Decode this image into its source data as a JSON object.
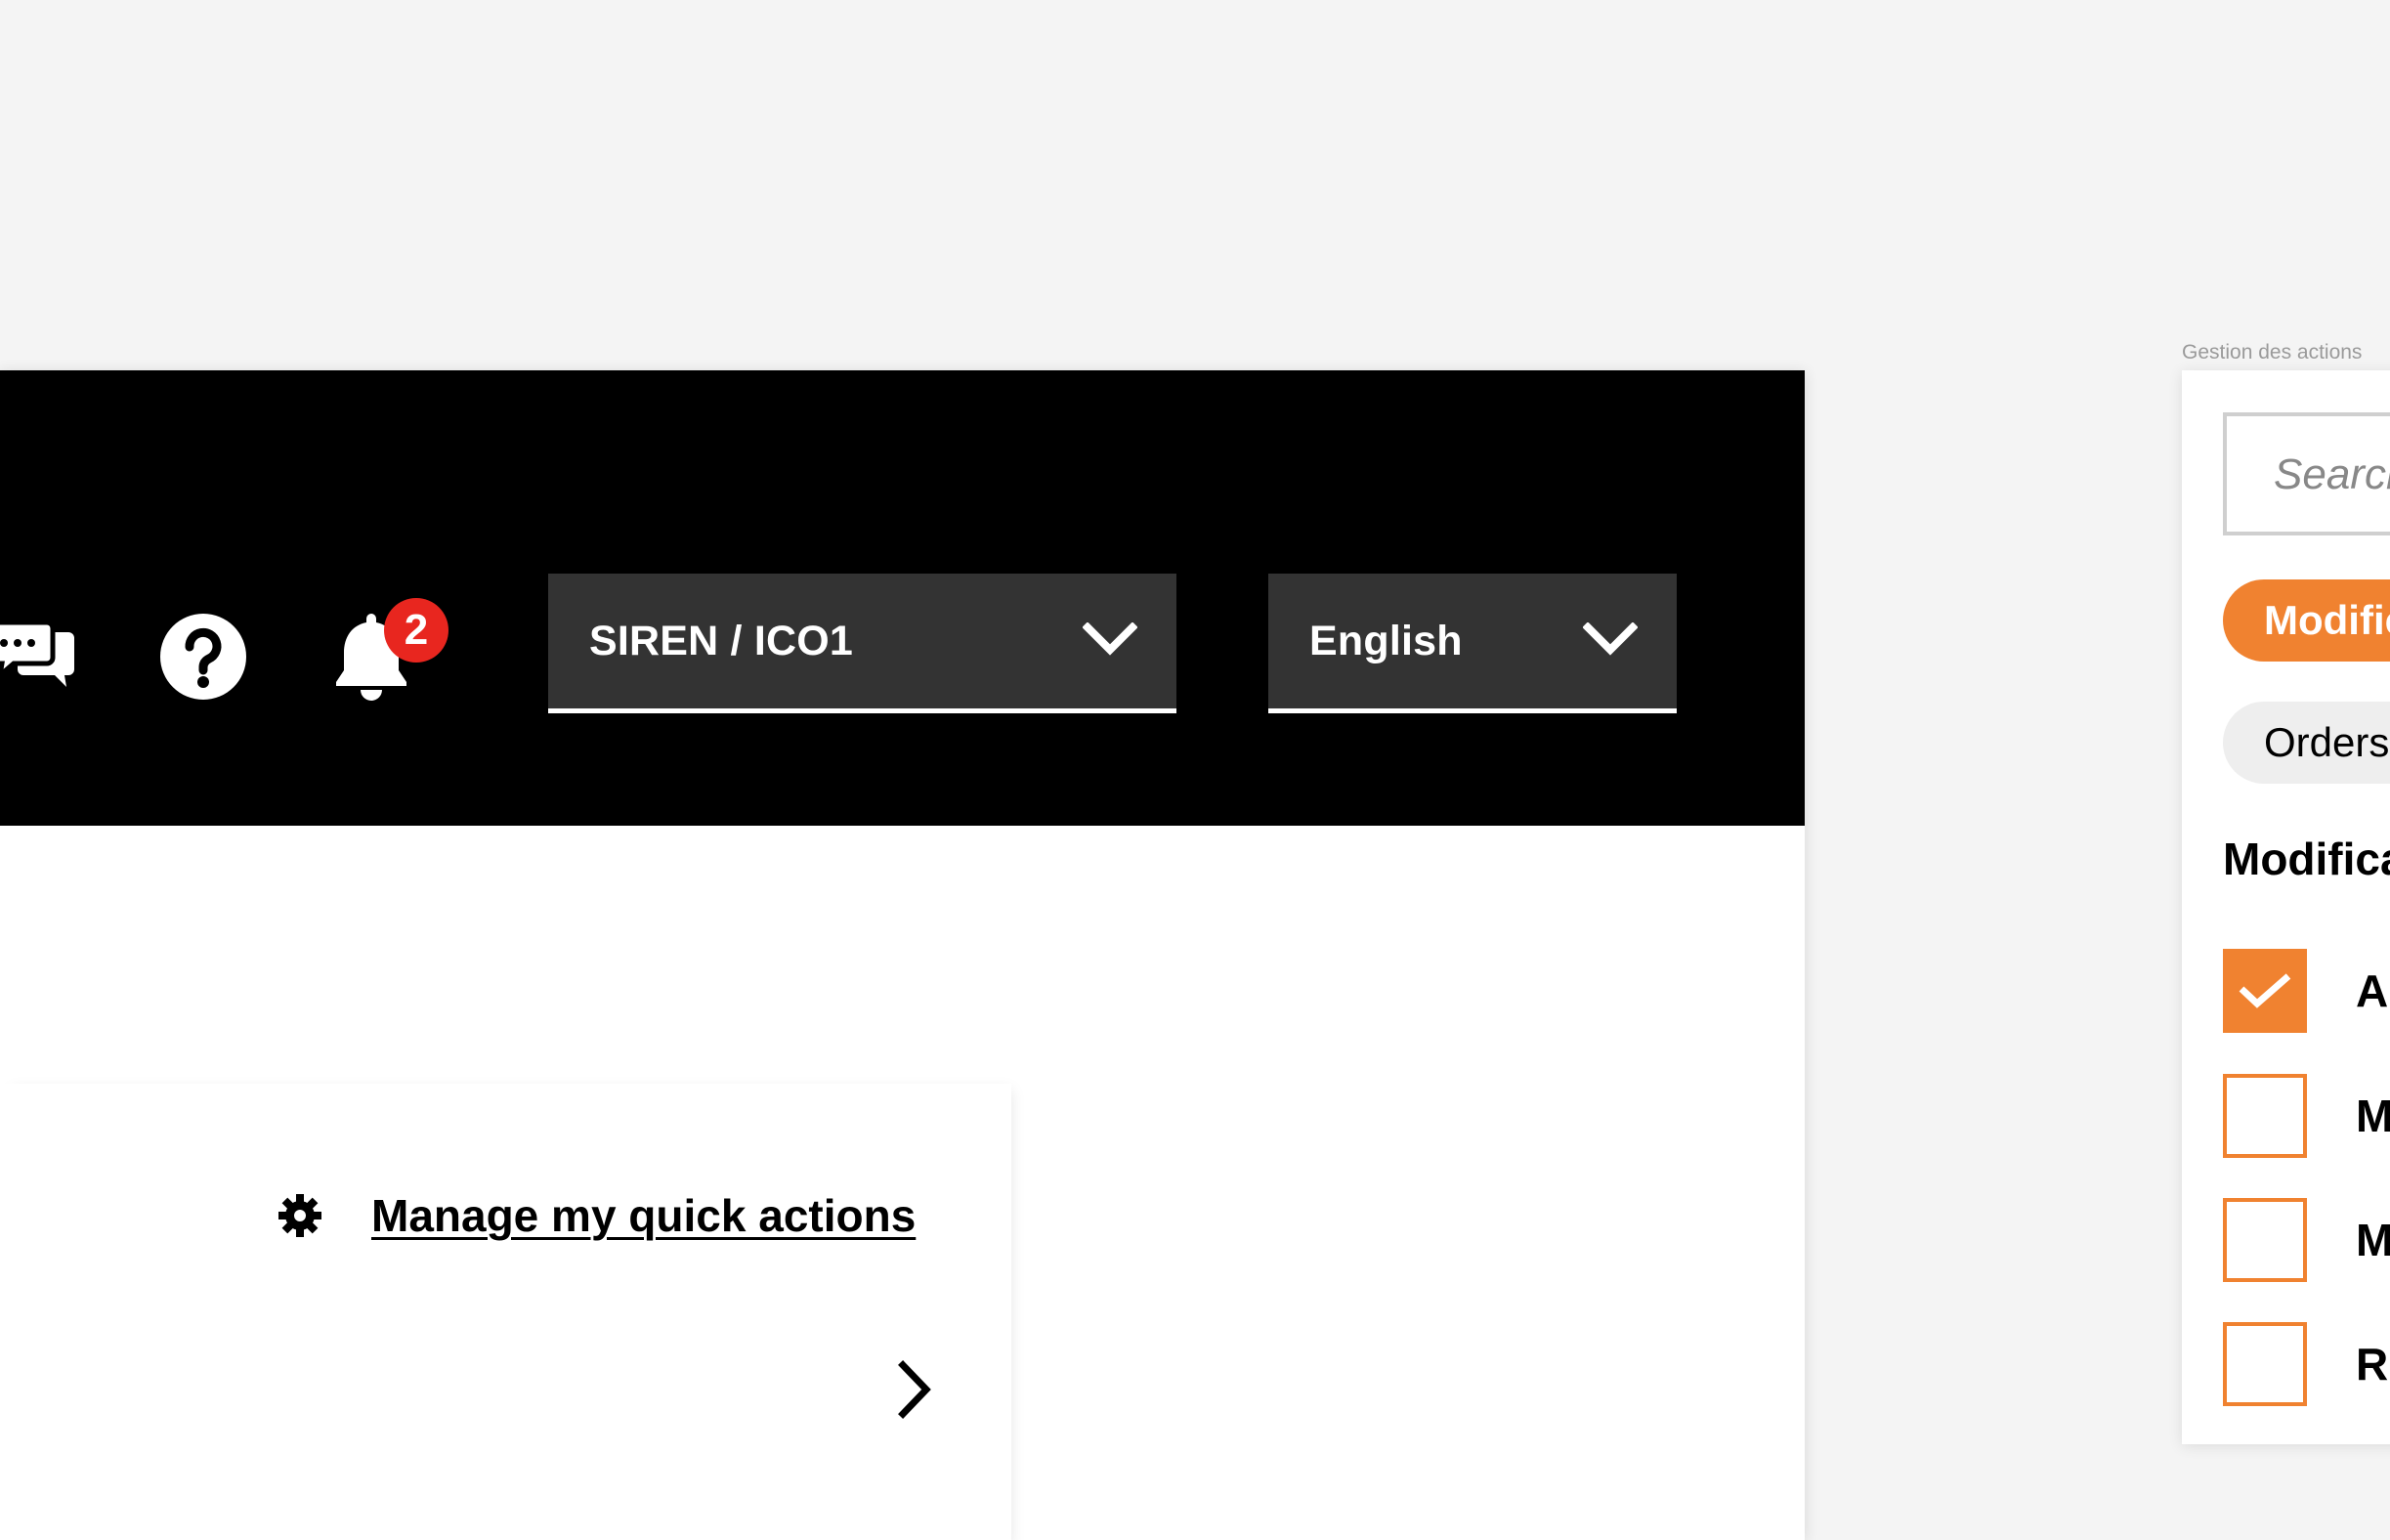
{
  "app": {
    "header": {
      "notification_count": "2",
      "org_select": {
        "value": "SIREN / ICO1"
      },
      "lang_select": {
        "value": "English"
      },
      "icons": [
        "chat-icon",
        "help-icon",
        "bell-icon",
        "chevron-down-icon"
      ]
    },
    "quick_actions": {
      "manage_label": "Manage my quick actions",
      "icons": [
        "gear-icon",
        "chevron-right-icon"
      ]
    }
  },
  "side_frame": {
    "label": "Gestion des actions",
    "search_placeholder": "Search",
    "filters": [
      {
        "label": "Modific",
        "active": true
      },
      {
        "label": "Orders",
        "active": false
      }
    ],
    "section_title": "Modifica",
    "checkboxes": [
      {
        "label": "Ac",
        "checked": true
      },
      {
        "label": "M",
        "checked": false
      },
      {
        "label": "M",
        "checked": false
      },
      {
        "label": "Re",
        "checked": false
      }
    ]
  },
  "colors": {
    "accent": "#f08230",
    "badge": "#e8261f",
    "header_bg": "#000000",
    "select_bg": "#333333",
    "canvas_bg": "#f4f4f4"
  }
}
